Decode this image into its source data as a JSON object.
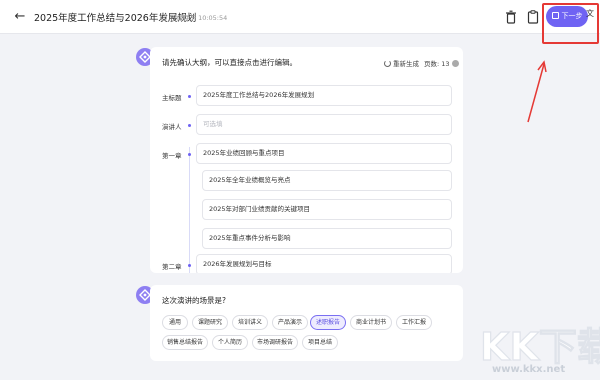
{
  "header": {
    "doc_title": "2025年度工作总结与2026年发展规划",
    "saved_text": "已保存于 10:05:54",
    "next_label": "下一步"
  },
  "outline_card": {
    "prompt": "请先确认大纲，可以直接点击进行编辑。",
    "regenerate_label": "重新生成",
    "pages_label": "页数: 13",
    "rows": [
      {
        "label": "主标题",
        "value": "2025年度工作总结与2026年发展规划",
        "placeholder": ""
      },
      {
        "label": "演讲人",
        "value": "",
        "placeholder": "可选填"
      },
      {
        "label": "第一章",
        "value": "2025年业绩回顾与重点项目",
        "placeholder": ""
      }
    ],
    "subitems": [
      "2025年全年业绩概览与亮点",
      "2025年对部门业绩贡献的关键项目",
      "2025年重点事件分析与影响"
    ],
    "next_chapter_label": "第二章",
    "next_chapter_value": "2026年发展规划与目标"
  },
  "scene_card": {
    "question": "这次演讲的场景是?",
    "options": [
      "通用",
      "课题研究",
      "培训讲义",
      "产品演示",
      "述职报告",
      "商业计划书",
      "工作汇报",
      "销售总结报告",
      "个人简历",
      "市场调研报告",
      "项目总结"
    ],
    "selected": "述职报告"
  },
  "watermark": {
    "text": "KK下载",
    "url": "www.kkx.net"
  },
  "colors": {
    "accent": "#6f63f3",
    "annotation": "#e53935"
  }
}
